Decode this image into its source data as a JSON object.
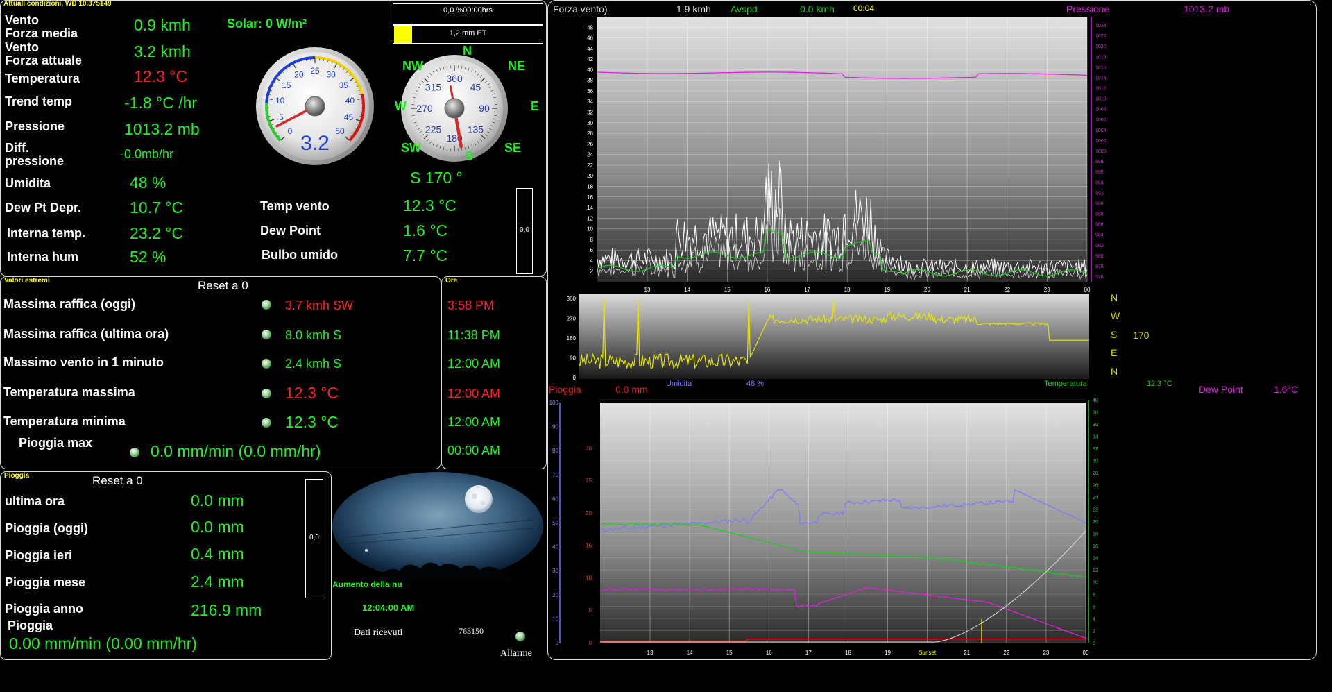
{
  "current": {
    "title": "Attuali condizioni, WD 10.375149",
    "rows": [
      {
        "label": "Vento",
        "label2": "Forza media",
        "value": "0.9 kmh",
        "color": "#22ee22"
      },
      {
        "label": "Vento",
        "label2": "Forza attuale",
        "value": "3.2 kmh",
        "color": "#22ee22"
      },
      {
        "label": "Temperatura",
        "value": "12.3 °C",
        "color": "#ff2020"
      },
      {
        "label": "Trend temp",
        "value": "-1.8 °C /hr",
        "color": "#22ee22"
      },
      {
        "label": "Pressione",
        "value": "1013.2 mb",
        "color": "#22ee22"
      },
      {
        "label": "Diff.",
        "label2": "pressione",
        "value": "-0.0mb/hr",
        "color": "#22ee22"
      },
      {
        "label": "Umidita",
        "value": "48 %",
        "color": "#22ee22"
      },
      {
        "label": "Dew Pt Depr.",
        "value": "10.7 °C",
        "color": "#22ee22"
      },
      {
        "label": "Interna temp.",
        "value": "23.2 °C",
        "color": "#22ee22"
      },
      {
        "label": "Interna hum",
        "value": "52 %",
        "color": "#22ee22"
      }
    ],
    "solar": "Solar: 0 W/m²",
    "right_rows": [
      {
        "label": "Temp vento",
        "value": "12.3 °C"
      },
      {
        "label": "Dew Point",
        "value": "1.6 °C"
      },
      {
        "label": "Bulbo umido",
        "value": "7.7 °C"
      }
    ],
    "rain_box_top": "0,0 %00:00hrs",
    "et_label": "1,2 mm ET",
    "et_fraction": 0.12,
    "bar_value": "0,0"
  },
  "speed_gauge": {
    "ticks": [
      "0",
      "5",
      "10",
      "15",
      "20",
      "25",
      "30",
      "35",
      "40",
      "45",
      "50"
    ],
    "value_text": "3.2",
    "current": 3.2,
    "max": 50
  },
  "compass": {
    "ticks": [
      "360",
      "45",
      "90",
      "135",
      "180",
      "225",
      "270",
      "315"
    ],
    "dirs": {
      "n": "N",
      "ne": "NE",
      "e": "E",
      "se": "SE",
      "s": "S",
      "sw": "SW",
      "w": "W",
      "nw": "NW"
    },
    "direction_text": "S 170 °",
    "bearing": 170
  },
  "extremes": {
    "title": "Valori estremi",
    "reset": "Reset a 0",
    "rows": [
      {
        "label": "Massima raffica (oggi)",
        "value": "3.7 kmh SW",
        "color": "#ff2020"
      },
      {
        "label": "Massima raffica (ultima ora)",
        "value": "8.0 kmh S",
        "color": "#22ee22"
      },
      {
        "label": "Massimo vento in 1 minuto",
        "value": "2.4 kmh S",
        "color": "#22ee22"
      },
      {
        "label": "Temperatura massima",
        "value": "12.3 °C",
        "color": "#ff2020"
      },
      {
        "label": "Temperatura minima",
        "value": "12.3 °C",
        "color": "#22ee22"
      }
    ],
    "rain_max_label": "Pioggia max",
    "rain_max_value": "0.0 mm/min (0.0 mm/hr)"
  },
  "times": {
    "title": "Ore",
    "rows": [
      {
        "value": "3:58 PM",
        "color": "#ff2020"
      },
      {
        "value": "11:38 PM",
        "color": "#22ee22"
      },
      {
        "value": "12:00 AM",
        "color": "#22ee22"
      },
      {
        "value": "12:00 AM",
        "color": "#ff2020"
      },
      {
        "value": "12:00 AM",
        "color": "#22ee22"
      },
      {
        "value": "00:00 AM",
        "color": "#22ee22"
      }
    ]
  },
  "rain": {
    "title": "Pioggia",
    "reset": "Reset a 0",
    "rows": [
      {
        "label": "ultima ora",
        "value": "0.0 mm"
      },
      {
        "label": "Pioggia (oggi)",
        "value": "0.0 mm"
      },
      {
        "label": "Pioggia ieri",
        "value": "0.4 mm"
      },
      {
        "label": "Pioggia mese",
        "value": "2.4 mm"
      },
      {
        "label": "Pioggia anno",
        "value": "216.9 mm"
      }
    ],
    "rate_label": "Pioggia",
    "rate_value": "0.00 mm/min (0.00 mm/hr)",
    "bar_value": "0,0"
  },
  "moon": {
    "caption": "Aumento della nu",
    "time": "12:04:00 AM",
    "received_label": "Dati ricevuti",
    "received_value": "763150",
    "alarm_label": "Allarme"
  },
  "charts": {
    "wind": {
      "title": "Forza vento)",
      "speed": "1.9 kmh",
      "avspd_label": "Avspd",
      "avspd_value": "0.0 kmh",
      "time": "00:04",
      "pressure_label": "Pressione",
      "pressure_value": "1013.2 mb",
      "y_ticks": [
        "2",
        "4",
        "6",
        "8",
        "10",
        "12",
        "14",
        "16",
        "18",
        "20",
        "22",
        "24",
        "26",
        "28",
        "30",
        "32",
        "34",
        "36",
        "38",
        "40",
        "42",
        "44",
        "46",
        "48"
      ],
      "y_right_ticks": [
        "976",
        "978",
        "980",
        "982",
        "984",
        "986",
        "988",
        "990",
        "992",
        "994",
        "996",
        "998",
        "1000",
        "1002",
        "1004",
        "1006",
        "1008",
        "1010",
        "1012",
        "1014",
        "1016",
        "1018",
        "1020",
        "1022",
        "1024"
      ],
      "x_ticks": [
        "13",
        "14",
        "15",
        "16",
        "17",
        "18",
        "19",
        "20",
        "21",
        "22",
        "23",
        "00"
      ]
    },
    "direction": {
      "y_ticks": [
        "0",
        "90",
        "180",
        "270",
        "360"
      ],
      "legend": [
        "N",
        "W",
        "S",
        "E",
        "N"
      ],
      "value": "170"
    },
    "temp": {
      "rain_label": "Pioggia",
      "rain_value": "0.0 mm",
      "hum_label": "Umidita",
      "hum_value": "48 %",
      "temp_label": "Temperatura",
      "temp_value": "12.3 °C",
      "dew_label": "Dew Point",
      "dew_value": "1.6°C",
      "y_hum_ticks": [
        "0",
        "10",
        "20",
        "30",
        "40",
        "50",
        "60",
        "70",
        "80",
        "90",
        "100"
      ],
      "y_left_ticks": [
        "0",
        "5",
        "10",
        "15",
        "20",
        "25",
        "30"
      ],
      "y_right_ticks": [
        "0",
        "2",
        "4",
        "6",
        "8",
        "10",
        "12",
        "14",
        "16",
        "18",
        "20",
        "22",
        "24",
        "26",
        "28",
        "30",
        "32",
        "34",
        "36",
        "38",
        "40"
      ],
      "x_ticks": [
        "13",
        "14",
        "15",
        "16",
        "17",
        "18",
        "19",
        "Sunset",
        "21",
        "22",
        "23",
        "00"
      ]
    }
  },
  "colors": {
    "green": "#22ee22",
    "red": "#ff2020",
    "yellow": "#ffff00",
    "magenta": "#e020e0",
    "humidity": "#8080ff"
  }
}
